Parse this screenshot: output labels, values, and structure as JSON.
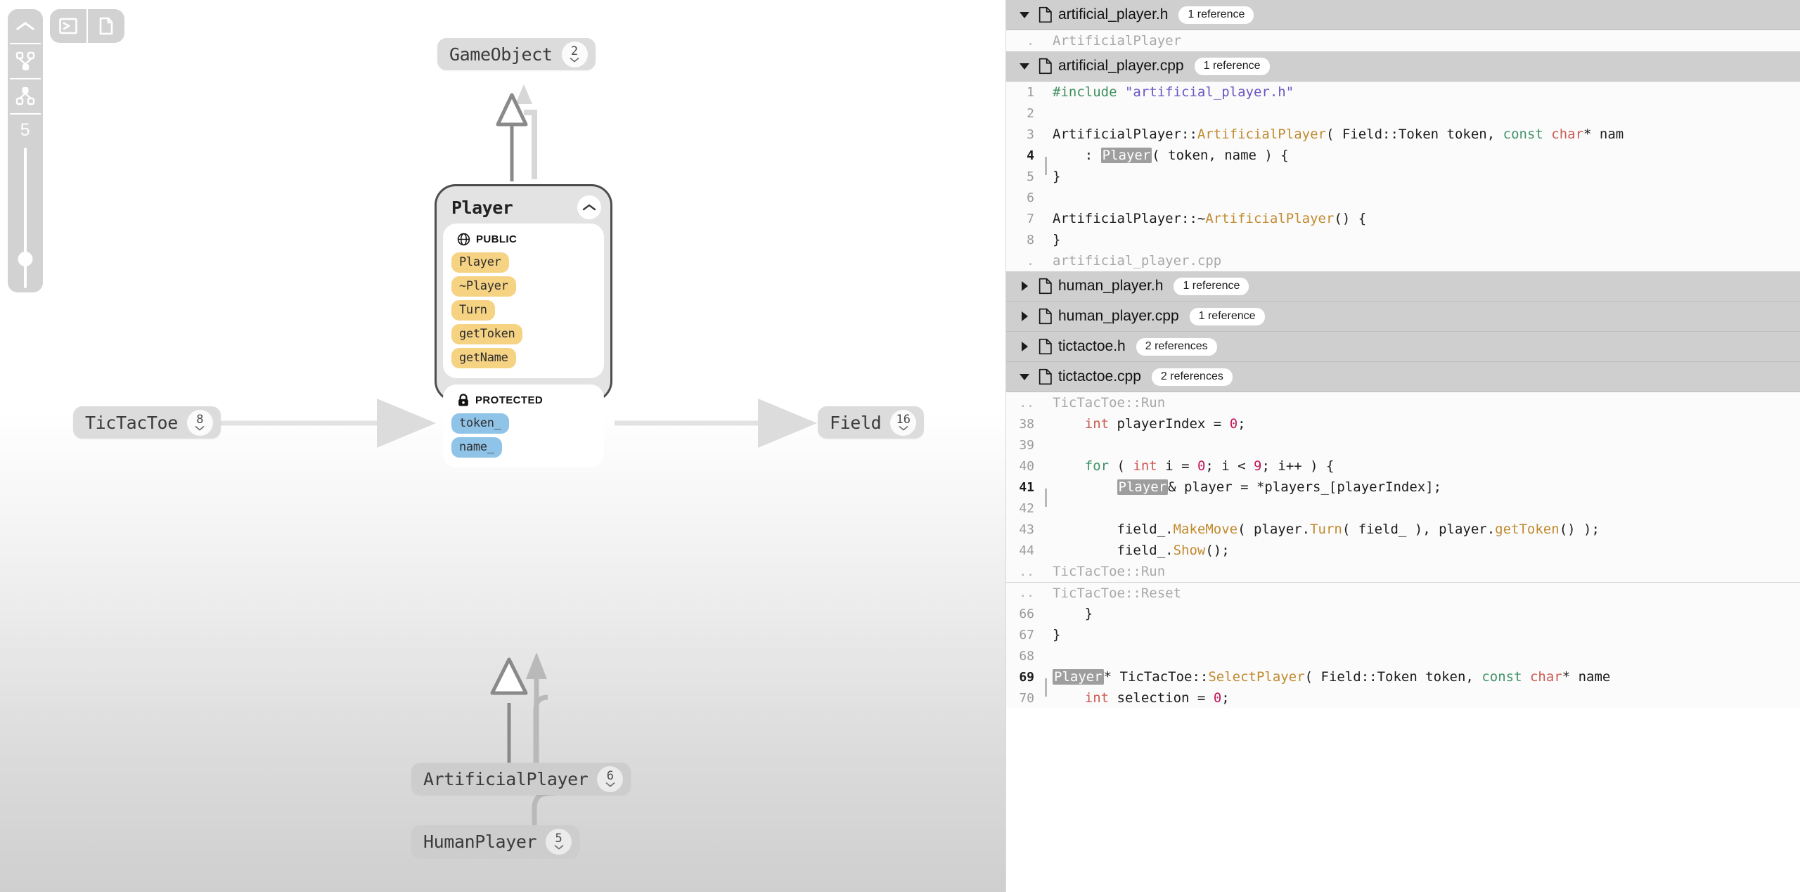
{
  "toolbar": {
    "collapse_button": "collapse-up",
    "dependents_button": "dependents-graph",
    "dependencies_button": "dependencies-graph",
    "depth_value": "5",
    "top_buttons": [
      "terminal-icon",
      "file-icon"
    ]
  },
  "graph": {
    "nodes": [
      {
        "id": "gameobject",
        "label": "GameObject",
        "count": "2"
      },
      {
        "id": "tictactoe",
        "label": "TicTacToe",
        "count": "8"
      },
      {
        "id": "field",
        "label": "Field",
        "count": "16"
      },
      {
        "id": "artificialplayer",
        "label": "ArtificialPlayer",
        "count": "6"
      },
      {
        "id": "humanplayer",
        "label": "HumanPlayer",
        "count": "5"
      }
    ],
    "player_card": {
      "title": "Player",
      "sections": [
        {
          "icon": "globe-icon",
          "label": "PUBLIC",
          "kind": "method",
          "members": [
            "Player",
            "~Player",
            "Turn",
            "getToken",
            "getName"
          ]
        },
        {
          "icon": "lock-icon",
          "label": "PROTECTED",
          "kind": "field",
          "members": [
            "token_",
            "name_"
          ]
        }
      ]
    }
  },
  "panel": {
    "files": [
      {
        "name": "artificial_player.h",
        "references": "1 reference",
        "expanded": true,
        "state_icon": "chevron-down-icon",
        "rows": [
          {
            "kind": "context",
            "gutter": ".",
            "label": "ArtificialPlayer"
          }
        ]
      },
      {
        "name": "artificial_player.cpp",
        "references": "1 reference",
        "expanded": true,
        "state_icon": "chevron-down-icon",
        "rows": [
          {
            "kind": "code",
            "gutter": "1",
            "current": false,
            "tokens": [
              {
                "t": "#include ",
                "c": "t-pre"
              },
              {
                "t": "\"artificial_player.h\"",
                "c": "t-str"
              }
            ]
          },
          {
            "kind": "code",
            "gutter": "2",
            "current": false,
            "tokens": []
          },
          {
            "kind": "code",
            "gutter": "3",
            "current": false,
            "tokens": [
              {
                "t": "ArtificialPlayer",
                "c": "t-plain"
              },
              {
                "t": "::",
                "c": "t-plain"
              },
              {
                "t": "ArtificialPlayer",
                "c": "t-type"
              },
              {
                "t": "( Field::Token token, ",
                "c": "t-plain"
              },
              {
                "t": "const",
                "c": "t-kw"
              },
              {
                "t": " ",
                "c": "t-plain"
              },
              {
                "t": "char",
                "c": "t-kw2"
              },
              {
                "t": "* nam",
                "c": "t-plain"
              }
            ]
          },
          {
            "kind": "code",
            "gutter": "4",
            "current": true,
            "tokens": [
              {
                "t": "    : ",
                "c": "t-plain"
              },
              {
                "t": "Player",
                "c": "t-hl"
              },
              {
                "t": "( token, name ) {",
                "c": "t-plain"
              }
            ]
          },
          {
            "kind": "code",
            "gutter": "5",
            "current": false,
            "tokens": [
              {
                "t": "}",
                "c": "t-plain"
              }
            ]
          },
          {
            "kind": "code",
            "gutter": "6",
            "current": false,
            "tokens": []
          },
          {
            "kind": "code",
            "gutter": "7",
            "current": false,
            "tokens": [
              {
                "t": "ArtificialPlayer",
                "c": "t-plain"
              },
              {
                "t": "::~",
                "c": "t-plain"
              },
              {
                "t": "ArtificialPlayer",
                "c": "t-type"
              },
              {
                "t": "() {",
                "c": "t-plain"
              }
            ]
          },
          {
            "kind": "code",
            "gutter": "8",
            "current": false,
            "tokens": [
              {
                "t": "}",
                "c": "t-plain"
              }
            ]
          },
          {
            "kind": "context",
            "gutter": ".",
            "label": "artificial_player.cpp"
          }
        ]
      },
      {
        "name": "human_player.h",
        "references": "1 reference",
        "expanded": false,
        "state_icon": "chevron-right-icon",
        "rows": []
      },
      {
        "name": "human_player.cpp",
        "references": "1 reference",
        "expanded": false,
        "state_icon": "chevron-right-icon",
        "rows": []
      },
      {
        "name": "tictactoe.h",
        "references": "2 references",
        "expanded": false,
        "state_icon": "chevron-right-icon",
        "rows": []
      },
      {
        "name": "tictactoe.cpp",
        "references": "2 references",
        "expanded": true,
        "state_icon": "chevron-down-icon",
        "rows": [
          {
            "kind": "context",
            "gutter": "..",
            "label": "TicTacToe::Run"
          },
          {
            "kind": "code",
            "gutter": "38",
            "current": false,
            "tokens": [
              {
                "t": "    ",
                "c": "t-plain"
              },
              {
                "t": "int",
                "c": "t-kw2"
              },
              {
                "t": " playerIndex = ",
                "c": "t-plain"
              },
              {
                "t": "0",
                "c": "t-num"
              },
              {
                "t": ";",
                "c": "t-plain"
              }
            ]
          },
          {
            "kind": "code",
            "gutter": "39",
            "current": false,
            "tokens": []
          },
          {
            "kind": "code",
            "gutter": "40",
            "current": false,
            "tokens": [
              {
                "t": "    ",
                "c": "t-plain"
              },
              {
                "t": "for",
                "c": "t-kw"
              },
              {
                "t": " ( ",
                "c": "t-plain"
              },
              {
                "t": "int",
                "c": "t-kw2"
              },
              {
                "t": " i = ",
                "c": "t-plain"
              },
              {
                "t": "0",
                "c": "t-num"
              },
              {
                "t": "; i < ",
                "c": "t-plain"
              },
              {
                "t": "9",
                "c": "t-num"
              },
              {
                "t": "; i++ ) {",
                "c": "t-plain"
              }
            ]
          },
          {
            "kind": "code",
            "gutter": "41",
            "current": true,
            "tokens": [
              {
                "t": "        ",
                "c": "t-plain"
              },
              {
                "t": "Player",
                "c": "t-hl"
              },
              {
                "t": "& player = *players_[playerIndex];",
                "c": "t-plain"
              }
            ]
          },
          {
            "kind": "code",
            "gutter": "42",
            "current": false,
            "tokens": []
          },
          {
            "kind": "code",
            "gutter": "43",
            "current": false,
            "tokens": [
              {
                "t": "        field_.",
                "c": "t-plain"
              },
              {
                "t": "MakeMove",
                "c": "t-fn"
              },
              {
                "t": "( player.",
                "c": "t-plain"
              },
              {
                "t": "Turn",
                "c": "t-fn"
              },
              {
                "t": "( field_ ), player.",
                "c": "t-plain"
              },
              {
                "t": "getToken",
                "c": "t-fn"
              },
              {
                "t": "() );",
                "c": "t-plain"
              }
            ]
          },
          {
            "kind": "code",
            "gutter": "44",
            "current": false,
            "tokens": [
              {
                "t": "        field_.",
                "c": "t-plain"
              },
              {
                "t": "Show",
                "c": "t-fn"
              },
              {
                "t": "();",
                "c": "t-plain"
              }
            ]
          },
          {
            "kind": "context",
            "gutter": "..",
            "label": "TicTacToe::Run"
          },
          {
            "kind": "context",
            "gutter": "..",
            "label": "TicTacToe::Reset",
            "separator": true
          },
          {
            "kind": "code",
            "gutter": "66",
            "current": false,
            "tokens": [
              {
                "t": "    }",
                "c": "t-plain"
              }
            ]
          },
          {
            "kind": "code",
            "gutter": "67",
            "current": false,
            "tokens": [
              {
                "t": "}",
                "c": "t-plain"
              }
            ]
          },
          {
            "kind": "code",
            "gutter": "68",
            "current": false,
            "tokens": []
          },
          {
            "kind": "code",
            "gutter": "69",
            "current": true,
            "tokens": [
              {
                "t": "Player",
                "c": "t-hl"
              },
              {
                "t": "* TicTacToe::",
                "c": "t-plain"
              },
              {
                "t": "SelectPlayer",
                "c": "t-fn"
              },
              {
                "t": "( Field::Token token, ",
                "c": "t-plain"
              },
              {
                "t": "const",
                "c": "t-kw"
              },
              {
                "t": " ",
                "c": "t-plain"
              },
              {
                "t": "char",
                "c": "t-kw2"
              },
              {
                "t": "* name",
                "c": "t-plain"
              }
            ]
          },
          {
            "kind": "code",
            "gutter": "70",
            "current": false,
            "tokens": [
              {
                "t": "    ",
                "c": "t-plain"
              },
              {
                "t": "int",
                "c": "t-kw2"
              },
              {
                "t": " selection = ",
                "c": "t-plain"
              },
              {
                "t": "0",
                "c": "t-num"
              },
              {
                "t": ";",
                "c": "t-plain"
              }
            ]
          }
        ]
      }
    ]
  },
  "colors": {
    "method_chip": "#f6d283",
    "field_chip": "#8fc4e8",
    "file_row": "#cfcfcf",
    "highlight": "#9e9e9e"
  }
}
